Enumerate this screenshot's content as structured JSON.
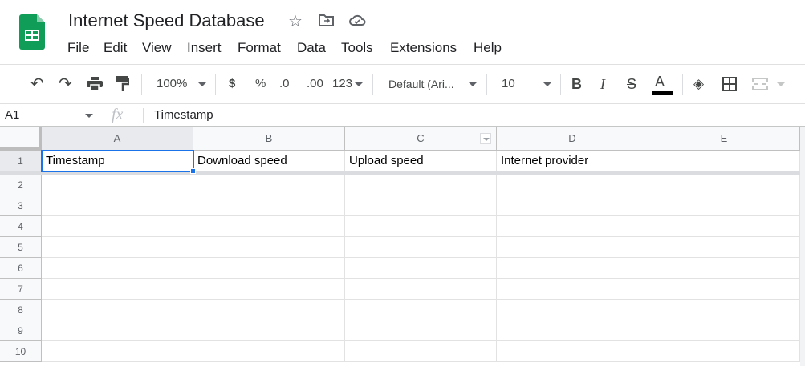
{
  "app": {
    "title": "Internet Speed Database",
    "brand_color": "#0f9d58",
    "icons": [
      "star-icon",
      "move-to-folder-icon",
      "cloud-saved-icon"
    ]
  },
  "menu": [
    "File",
    "Edit",
    "View",
    "Insert",
    "Format",
    "Data",
    "Tools",
    "Extensions",
    "Help"
  ],
  "toolbar": {
    "zoom": "100%",
    "currency": "$",
    "percent": "%",
    "decrease_decimal": ".0",
    "increase_decimal": ".00",
    "number_format": "123",
    "font": "Default (Ari...",
    "font_size": "10",
    "bold": "B",
    "italic": "I",
    "strikethrough": "S",
    "text_color": "A",
    "text_color_value": "#000000"
  },
  "formula_bar": {
    "cell_ref": "A1",
    "fx": "fx",
    "value": "Timestamp"
  },
  "grid": {
    "columns": [
      "A",
      "B",
      "C",
      "D",
      "E"
    ],
    "rows": [
      "1",
      "2",
      "3",
      "4",
      "5",
      "6",
      "7",
      "8",
      "9",
      "10"
    ],
    "header_row": [
      "Timestamp",
      "Download speed",
      "Upload speed",
      "Internet provider",
      ""
    ],
    "selected_cell": "A1",
    "selection_color": "#1a73e8"
  }
}
